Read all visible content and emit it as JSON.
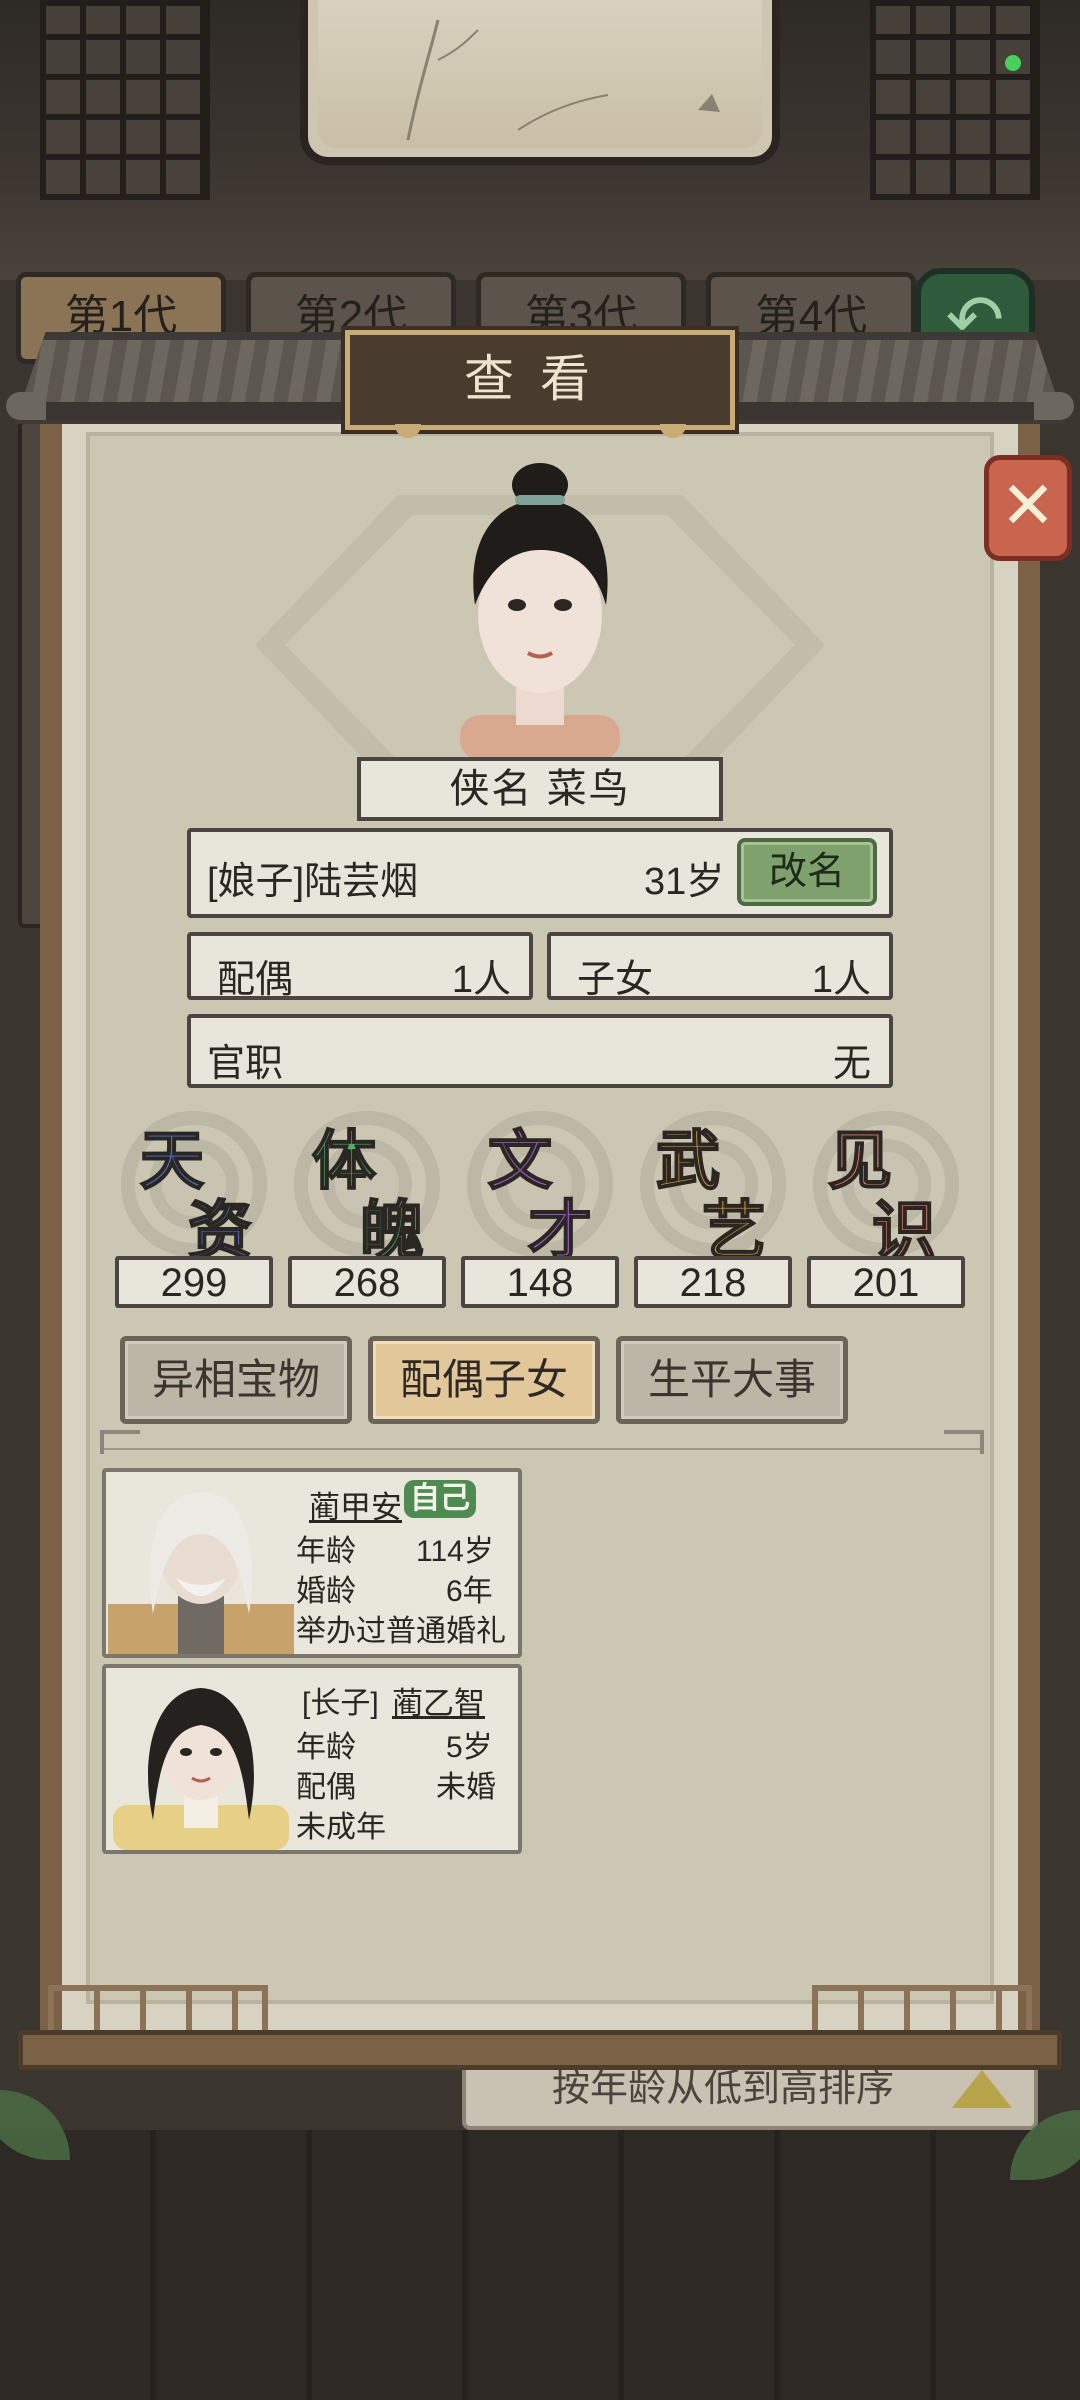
{
  "background": {
    "generation_tabs": [
      "第1代",
      "第2代",
      "第3代",
      "第4代"
    ],
    "sort_label": "按年龄从低到高排序"
  },
  "panel": {
    "title": "查看"
  },
  "character": {
    "alias_label": "侠名",
    "alias": "菜鸟",
    "name": "[娘子]陆芸烟",
    "age": "31岁",
    "rename_label": "改名",
    "spouse_label": "配偶",
    "spouse_count": "1人",
    "children_label": "子女",
    "children_count": "1人",
    "office_label": "官职",
    "office_value": "无"
  },
  "stats": [
    {
      "char1": "天",
      "char2": "资",
      "value": "299",
      "color1": "#4f6fd8",
      "color2": "#4f6fd8"
    },
    {
      "char1": "体",
      "char2": "魄",
      "value": "268",
      "color1": "#4caf6a",
      "color2": "#4caf6a"
    },
    {
      "char1": "文",
      "char2": "才",
      "value": "148",
      "color1": "#a55ad1",
      "color2": "#a55ad1"
    },
    {
      "char1": "武",
      "char2": "艺",
      "value": "218",
      "color1": "#e0a840",
      "color2": "#e0a840"
    },
    {
      "char1": "见",
      "char2": "识",
      "value": "201",
      "color1": "#e07a68",
      "color2": "#e07a68"
    }
  ],
  "sub_tabs": [
    "异相宝物",
    "配偶子女",
    "生平大事"
  ],
  "members": [
    {
      "name": "蔺甲安",
      "badge": "自己",
      "line1_label": "年龄",
      "line1_value": "114岁",
      "line2_label": "婚龄",
      "line2_value": "6年",
      "line3": "举办过普通婚礼"
    },
    {
      "prefix": "[长子]",
      "name": "蔺乙智",
      "line1_label": "年龄",
      "line1_value": "5岁",
      "line2_label": "配偶",
      "line2_value": "未婚",
      "line3": "未成年"
    }
  ],
  "colors": {
    "accent_green": "#7fa16d",
    "frame_brown": "#7b6247",
    "paper": "#cbc7b3"
  }
}
